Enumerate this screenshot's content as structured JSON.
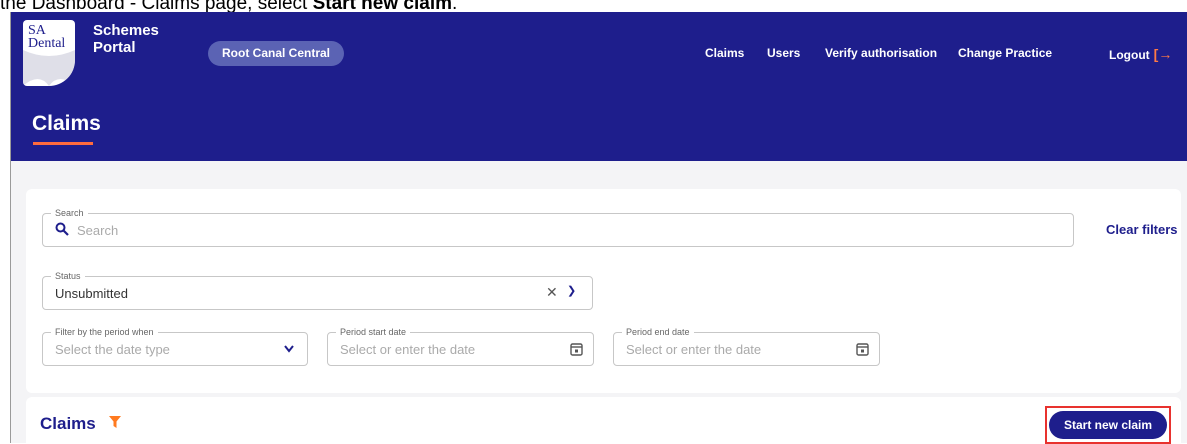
{
  "instruction": {
    "prefix": "the Dashboard - Claims page, select ",
    "action": "Start new claim",
    "suffix": "."
  },
  "brand": {
    "logo_text": "SA\nDental",
    "portal_name": "Schemes\nPortal",
    "primary_color": "#1e1e8c",
    "accent_color": "#ff6b3d"
  },
  "header": {
    "practice": "Root Canal Central",
    "nav": [
      "Claims",
      "Users",
      "Verify authorisation",
      "Change Practice"
    ],
    "logout": "Logout",
    "page_title": "Claims"
  },
  "filters": {
    "search": {
      "label": "Search",
      "placeholder": "Search"
    },
    "clear_filters": "Clear filters",
    "status": {
      "label": "Status",
      "value": "Unsubmitted"
    },
    "period_type": {
      "label": "Filter by the period when",
      "placeholder": "Select the date type"
    },
    "start_date": {
      "label": "Period start date",
      "placeholder": "Select or enter the date"
    },
    "end_date": {
      "label": "Period end date",
      "placeholder": "Select or enter the date"
    }
  },
  "claims_section": {
    "title": "Claims",
    "start_button": "Start new claim",
    "highlight_color": "#e8322e"
  }
}
